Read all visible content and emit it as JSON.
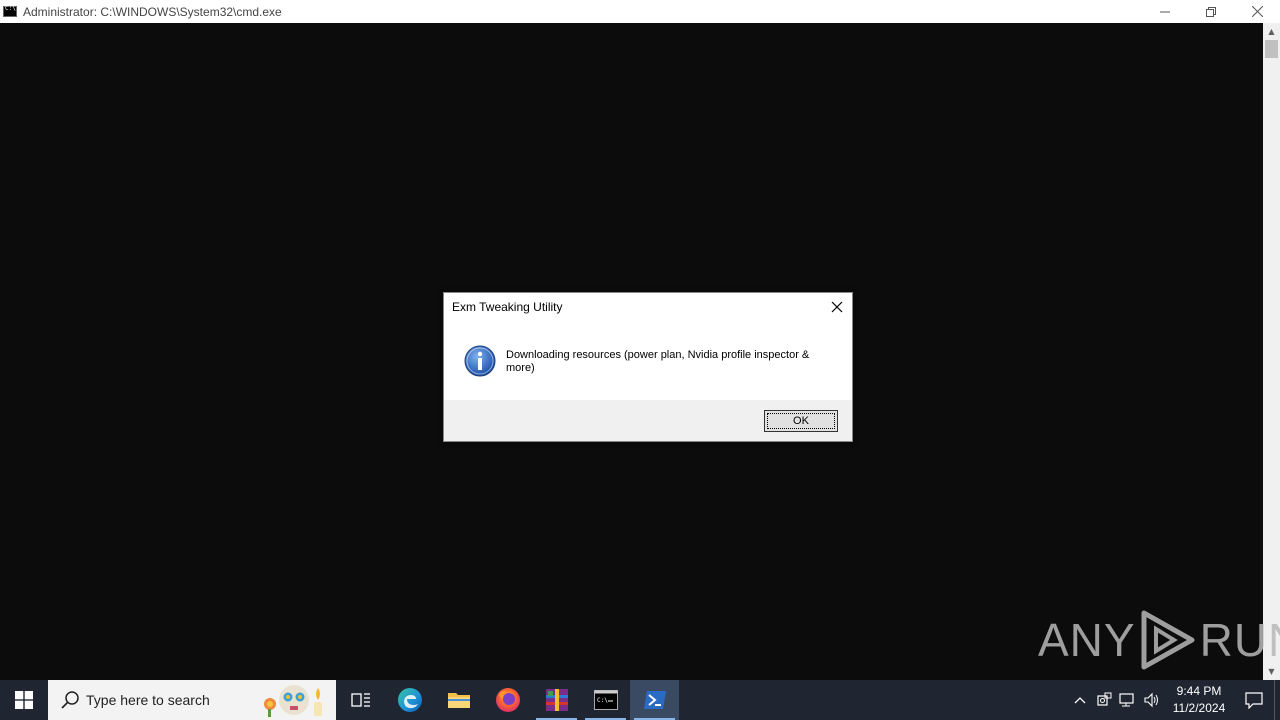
{
  "window": {
    "title": "Administrator: C:\\WINDOWS\\System32\\cmd.exe",
    "controls": {
      "minimize": "—",
      "restore": "❐",
      "close": "✕"
    }
  },
  "dialog": {
    "title": "Exm Tweaking Utility",
    "message": "Downloading resources (power plan, Nvidia profile inspector & more)",
    "ok_label": "OK",
    "icon": "info-icon"
  },
  "watermark": {
    "left": "ANY",
    "right": "RUN"
  },
  "taskbar": {
    "search_placeholder": "Type here to search",
    "apps": [
      {
        "name": "task-view",
        "icon": "task-view-icon"
      },
      {
        "name": "edge",
        "icon": "edge-icon"
      },
      {
        "name": "file-explorer",
        "icon": "folder-icon"
      },
      {
        "name": "firefox",
        "icon": "firefox-icon"
      },
      {
        "name": "winrar",
        "icon": "winrar-icon"
      },
      {
        "name": "cmd",
        "icon": "cmd-icon"
      },
      {
        "name": "powershell",
        "icon": "powershell-icon"
      }
    ],
    "clock": {
      "time": "9:44 PM",
      "date": "11/2/2024"
    }
  },
  "colors": {
    "console_bg": "#0c0c0c",
    "taskbar_bg": "#1f2631",
    "dialog_footer": "#f0f0f0"
  }
}
